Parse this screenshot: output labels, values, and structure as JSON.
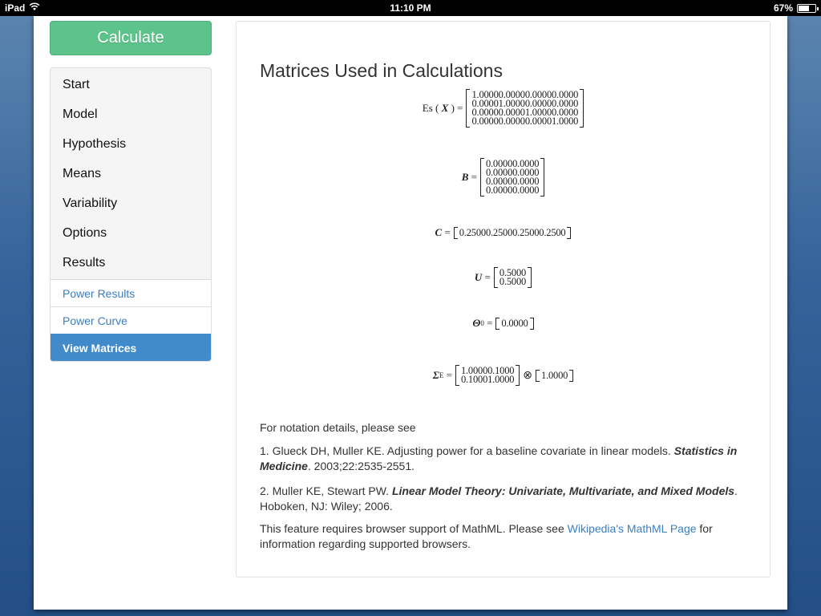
{
  "status_bar": {
    "device": "iPad",
    "time": "11:10 PM",
    "battery": "67%",
    "battery_level": 0.67
  },
  "sidebar": {
    "calculate_label": "Calculate",
    "items": [
      {
        "label": "Start"
      },
      {
        "label": "Model"
      },
      {
        "label": "Hypothesis"
      },
      {
        "label": "Means"
      },
      {
        "label": "Variability"
      },
      {
        "label": "Options"
      },
      {
        "label": "Results"
      }
    ],
    "sub_items": [
      {
        "label": "Power Results"
      },
      {
        "label": "Power Curve"
      },
      {
        "label": "View Matrices",
        "active": true
      }
    ]
  },
  "main": {
    "title": "Matrices Used in Calculations",
    "matrices": {
      "es_x": {
        "label_prefix": "Es",
        "label_var": "X",
        "rows": [
          "1.00000.00000.00000.0000",
          "0.00001.00000.00000.0000",
          "0.00000.00001.00000.0000",
          "0.00000.00000.00001.0000"
        ]
      },
      "b": {
        "label_var": "B",
        "rows": [
          "0.00000.0000",
          "0.00000.0000",
          "0.00000.0000",
          "0.00000.0000"
        ]
      },
      "c": {
        "label_var": "C",
        "rows": [
          "0.25000.25000.25000.2500"
        ]
      },
      "u": {
        "label_var": "U",
        "rows": [
          "0.5000",
          "0.5000"
        ]
      },
      "theta": {
        "label_var": "Θ",
        "label_sub": "0",
        "rows": [
          "0.0000"
        ]
      },
      "sigma": {
        "label_var": "Σ",
        "label_sub": "E",
        "rows_a": [
          "1.00000.1000",
          "0.10001.0000"
        ],
        "operator": "⊗",
        "rows_b": [
          "1.0000"
        ]
      }
    },
    "notation_intro": "For notation details, please see",
    "ref1": {
      "text_before": "1. Glueck DH, Muller KE. Adjusting power for a baseline covariate in linear models. ",
      "journal": "Statistics in Medicine",
      "text_after": ". 2003;22:2535-2551."
    },
    "ref2": {
      "text_before": "2. Muller KE, Stewart PW. ",
      "book": "Linear Model Theory: Univariate, Multivariate, and Mixed Models",
      "text_after": ". Hoboken, NJ: Wiley; 2006."
    },
    "mathml_note": {
      "before": "This feature requires browser support of MathML. Please see ",
      "link": "Wikipedia's MathML Page",
      "after": " for information regarding supported browsers."
    }
  }
}
